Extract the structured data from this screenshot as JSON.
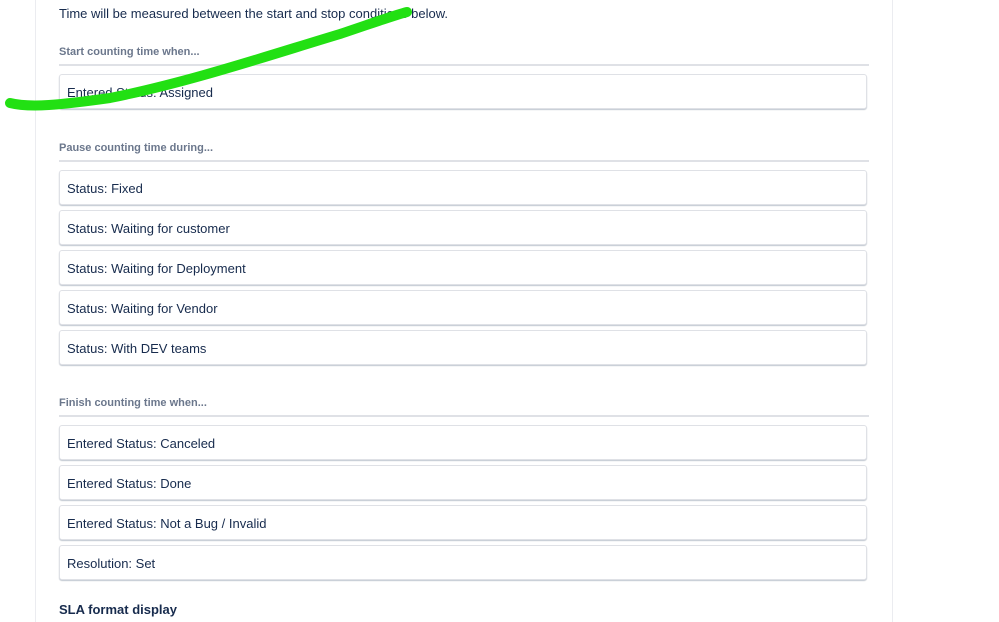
{
  "intro_text": "Time will be measured between the start and stop conditions below.",
  "sections": {
    "start": {
      "heading": "Start counting time when...",
      "items": [
        "Entered Status: Assigned"
      ]
    },
    "pause": {
      "heading": "Pause counting time during...",
      "items": [
        "Status: Fixed",
        "Status: Waiting for customer",
        "Status: Waiting for Deployment",
        "Status: Waiting for Vendor",
        "Status: With DEV teams"
      ]
    },
    "finish": {
      "heading": "Finish counting time when...",
      "items": [
        "Entered Status: Canceled",
        "Entered Status: Done",
        "Entered Status: Not a Bug / Invalid",
        "Resolution: Set"
      ]
    }
  },
  "sla_format_title": "SLA format display",
  "colors": {
    "annotation_stroke": "#22e013",
    "heading_text": "#6b778c",
    "body_text": "#172b4d",
    "border": "#dfe1e6"
  }
}
